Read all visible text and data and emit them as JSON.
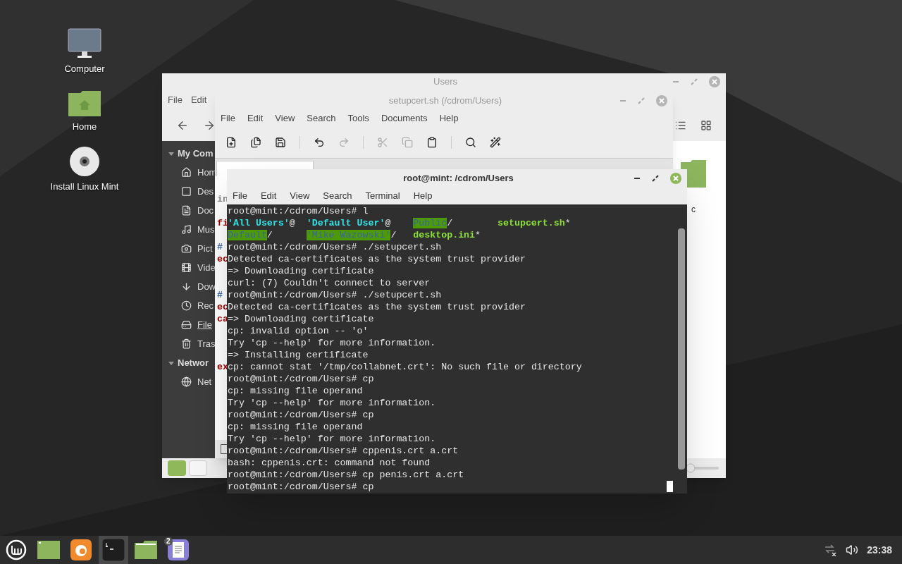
{
  "desktop_icons": [
    {
      "kind": "computer",
      "label": "Computer"
    },
    {
      "kind": "home",
      "label": "Home"
    },
    {
      "kind": "disc",
      "label": "Install Linux Mint"
    }
  ],
  "file_manager": {
    "title": "Users",
    "menu": [
      "File",
      "Edit"
    ],
    "sidebar": [
      {
        "heading": "My Com",
        "expanded": true,
        "items": [
          {
            "kind": "home",
            "label": "Hom",
            "underline": false
          },
          {
            "kind": "desktop",
            "label": "Des",
            "underline": false
          },
          {
            "kind": "document",
            "label": "Doc",
            "underline": false
          },
          {
            "kind": "music",
            "label": "Mus",
            "underline": false
          },
          {
            "kind": "pictures",
            "label": "Pict",
            "underline": false
          },
          {
            "kind": "video",
            "label": "Vide",
            "underline": false
          },
          {
            "kind": "download",
            "label": "Dow",
            "underline": false
          },
          {
            "kind": "recent",
            "label": "Rec",
            "underline": false
          },
          {
            "kind": "drive",
            "label": "File",
            "underline": true
          },
          {
            "kind": "trash",
            "label": "Tras",
            "underline": false
          }
        ]
      },
      {
        "heading": "Networ",
        "expanded": true,
        "items": [
          {
            "kind": "network",
            "label": "Net",
            "underline": false
          }
        ]
      }
    ],
    "file_label": "c",
    "zoom": {
      "level": 0.05
    }
  },
  "editor": {
    "title": "setupcert.sh (/cdrom/Users)",
    "menu": [
      "File",
      "Edit",
      "View",
      "Search",
      "Tools",
      "Documents",
      "Help"
    ],
    "toolbar": [
      {
        "kind": "new",
        "disabled": false
      },
      {
        "kind": "open",
        "disabled": false
      },
      {
        "kind": "save",
        "disabled": false
      },
      {
        "kind": "sep"
      },
      {
        "kind": "undo",
        "disabled": false
      },
      {
        "kind": "redo",
        "disabled": true
      },
      {
        "kind": "sep"
      },
      {
        "kind": "cut",
        "disabled": true
      },
      {
        "kind": "copy",
        "disabled": true
      },
      {
        "kind": "paste",
        "disabled": false
      },
      {
        "kind": "sep"
      },
      {
        "kind": "search",
        "disabled": false
      },
      {
        "kind": "replace",
        "disabled": false
      }
    ],
    "code": [
      {
        "kind": "plain",
        "text": "in"
      },
      {
        "kind": "blank"
      },
      {
        "kind": "keyword",
        "text": "fi"
      },
      {
        "kind": "blank"
      },
      {
        "kind": "comment",
        "text": "#"
      },
      {
        "kind": "keyword",
        "text": "ec"
      },
      {
        "kind": "blank"
      },
      {
        "kind": "blank"
      },
      {
        "kind": "comment",
        "text": "#"
      },
      {
        "kind": "keyword",
        "text": "ec"
      },
      {
        "kind": "keyword",
        "text": "ca"
      },
      {
        "kind": "blank"
      },
      {
        "kind": "blank"
      },
      {
        "kind": "blank"
      },
      {
        "kind": "keyword",
        "text": "ex"
      }
    ]
  },
  "terminal": {
    "title": "root@mint: /cdrom/Users",
    "menu": [
      "File",
      "Edit",
      "View",
      "Search",
      "Terminal",
      "Help"
    ],
    "cursor": true,
    "lines": [
      {
        "kind": "text",
        "text": "root@mint:/cdrom/Users# l"
      },
      {
        "kind": "listing",
        "rows": [
          [
            {
              "name": "'All Users'",
              "kind": "link",
              "suffix": "@"
            },
            {
              "name": "'Default User'",
              "kind": "link",
              "suffix": "@"
            },
            {
              "name": "Public",
              "kind": "shared",
              "suffix": "/"
            },
            {
              "name": "setupcert.sh",
              "kind": "exec",
              "suffix": "*"
            }
          ],
          [
            {
              "name": "Default",
              "kind": "shared",
              "suffix": "/"
            },
            {
              "name": "'Mike Wazowski'",
              "kind": "shared",
              "suffix": "/"
            },
            {
              "name": "desktop.ini",
              "kind": "exec",
              "suffix": "*"
            }
          ]
        ]
      },
      {
        "kind": "text",
        "text": "root@mint:/cdrom/Users# ./setupcert.sh"
      },
      {
        "kind": "text",
        "text": "Detected ca-certificates as the system trust provider"
      },
      {
        "kind": "text",
        "text": "=> Downloading certificate"
      },
      {
        "kind": "text",
        "text": "curl: (7) Couldn't connect to server"
      },
      {
        "kind": "text",
        "text": "root@mint:/cdrom/Users# ./setupcert.sh"
      },
      {
        "kind": "text",
        "text": "Detected ca-certificates as the system trust provider"
      },
      {
        "kind": "text",
        "text": "=> Downloading certificate"
      },
      {
        "kind": "text",
        "text": "cp: invalid option -- 'o'"
      },
      {
        "kind": "text",
        "text": "Try 'cp --help' for more information."
      },
      {
        "kind": "text",
        "text": "=> Installing certificate"
      },
      {
        "kind": "text",
        "text": "cp: cannot stat '/tmp/collabnet.crt': No such file or directory"
      },
      {
        "kind": "text",
        "text": "root@mint:/cdrom/Users# cp"
      },
      {
        "kind": "text",
        "text": "cp: missing file operand"
      },
      {
        "kind": "text",
        "text": "Try 'cp --help' for more information."
      },
      {
        "kind": "text",
        "text": "root@mint:/cdrom/Users# cp"
      },
      {
        "kind": "text",
        "text": "cp: missing file operand"
      },
      {
        "kind": "text",
        "text": "Try 'cp --help' for more information."
      },
      {
        "kind": "text",
        "text": "root@mint:/cdrom/Users# cppenis.crt a.crt"
      },
      {
        "kind": "text",
        "text": "bash: cppenis.crt: command not found"
      },
      {
        "kind": "text",
        "text": "root@mint:/cdrom/Users# cp penis.crt a.crt"
      },
      {
        "kind": "text",
        "text": "root@mint:/cdrom/Users# cp"
      }
    ]
  },
  "taskbar": {
    "apps": [
      {
        "kind": "menu",
        "active": false
      },
      {
        "kind": "show-desktop",
        "active": false
      },
      {
        "kind": "browser",
        "active": false
      },
      {
        "kind": "terminal",
        "active": true
      },
      {
        "kind": "files",
        "active": false
      },
      {
        "kind": "editor",
        "active": false,
        "badge": "2"
      }
    ],
    "clock": "23:38"
  }
}
